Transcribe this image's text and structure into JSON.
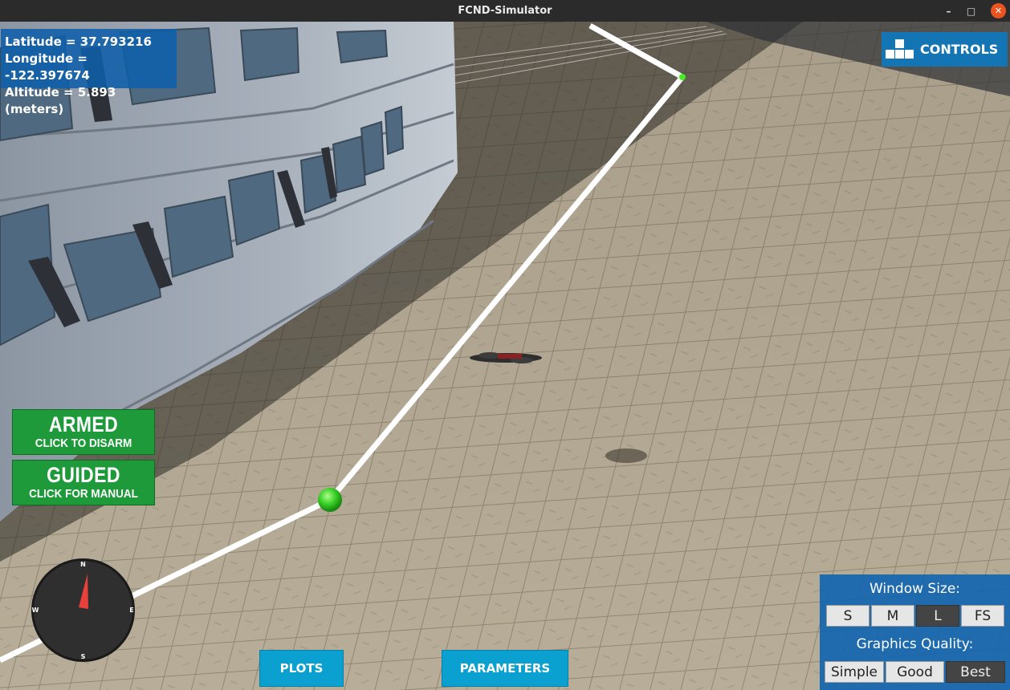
{
  "window": {
    "title": "FCND-Simulator",
    "minimize_glyph": "–",
    "maximize_glyph": "□",
    "close_glyph": "✕"
  },
  "telemetry": {
    "latitude": "Latitude = 37.793216",
    "longitude": "Longitude = -122.397674",
    "altitude": "Altitude = 5.893 (meters)"
  },
  "controls_button": {
    "label": "CONTROLS",
    "icon": "controls-grid-icon"
  },
  "armed_button": {
    "title": "ARMED",
    "subtitle": "CLICK TO DISARM",
    "color": "#1e9a3a"
  },
  "guided_button": {
    "title": "GUIDED",
    "subtitle": "CLICK FOR MANUAL",
    "color": "#1e9a3a"
  },
  "compass": {
    "north": "N",
    "south": "S",
    "east": "E",
    "west": "W",
    "icon": "compass-icon"
  },
  "bottom_buttons": {
    "plots": "PLOTS",
    "parameters": "PARAMETERS"
  },
  "settings_panel": {
    "window_size_label": "Window Size:",
    "window_sizes": [
      "S",
      "M",
      "L",
      "FS"
    ],
    "selected_window_size": "L",
    "graphics_quality_label": "Graphics Quality:",
    "graphics_qualities": [
      "Simple",
      "Good",
      "Best"
    ],
    "selected_graphics_quality": "Best"
  },
  "colors": {
    "hud_blue": "#0f5faa",
    "button_cyan": "#0aa0cf",
    "mode_green": "#1e9a3a",
    "waypoint_green": "#33dd22",
    "path_white": "#ffffff"
  }
}
